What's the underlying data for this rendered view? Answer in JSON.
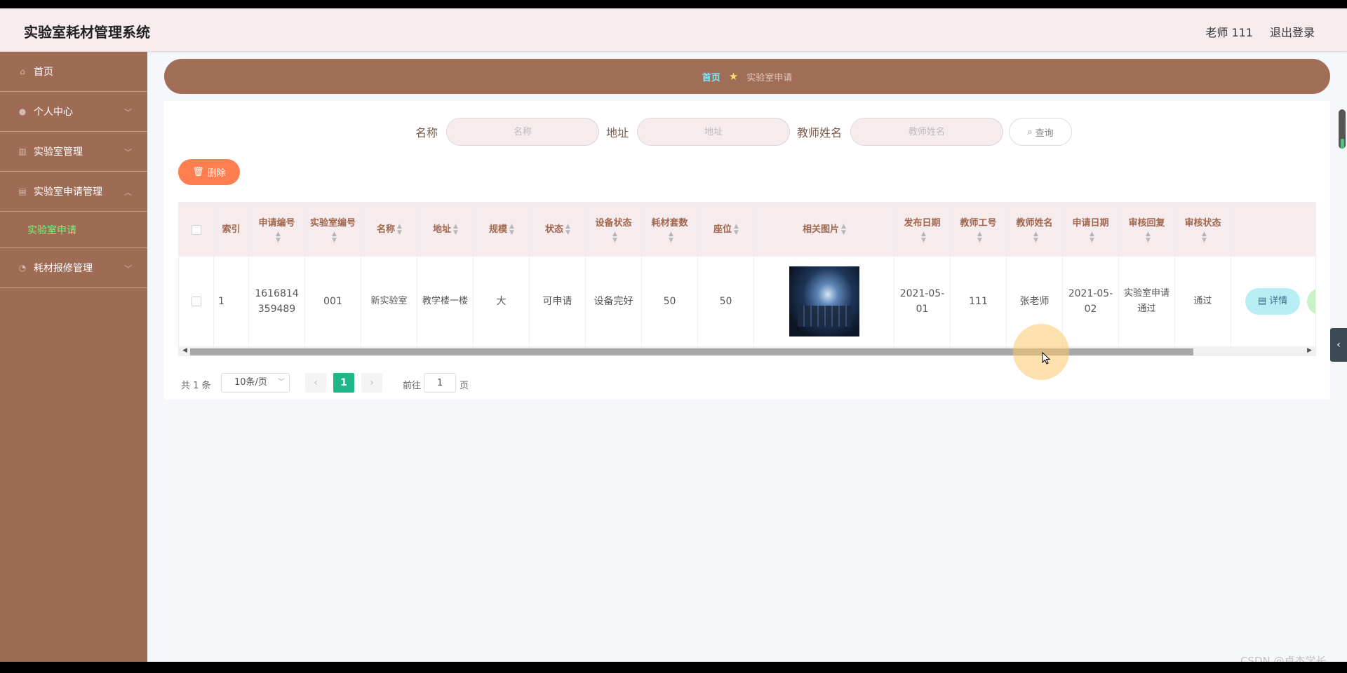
{
  "header": {
    "title": "实验室耗材管理系统",
    "user": "老师 111",
    "logout": "退出登录"
  },
  "sidebar": {
    "items": [
      {
        "label": "首页",
        "icon": "home-icon"
      },
      {
        "label": "个人中心",
        "icon": "user-icon"
      },
      {
        "label": "实验室管理",
        "icon": "chart-icon"
      },
      {
        "label": "实验室申请管理",
        "icon": "clipboard-icon",
        "sub": "实验室申请"
      },
      {
        "label": "耗材报修管理",
        "icon": "dashboard-icon"
      }
    ]
  },
  "breadcrumb": {
    "home": "首页",
    "current": "实验室申请"
  },
  "search": {
    "name_label": "名称",
    "name_placeholder": "名称",
    "address_label": "地址",
    "address_placeholder": "地址",
    "teacher_label": "教师姓名",
    "teacher_placeholder": "教师姓名",
    "query_button": "查询"
  },
  "toolbar": {
    "delete_button": "删除"
  },
  "table": {
    "headers": {
      "index": "索引",
      "app_no": "申请编号",
      "lab_no": "实验室编号",
      "name": "名称",
      "address": "地址",
      "scale": "规模",
      "status": "状态",
      "device_status": "设备状态",
      "material_sets": "耗材套数",
      "seats": "座位",
      "image": "相关图片",
      "publish_date": "发布日期",
      "teacher_id": "教师工号",
      "teacher_name": "教师姓名",
      "apply_date": "申请日期",
      "review_reply": "审核回复",
      "review_status": "审核状态"
    },
    "row": {
      "index": "1",
      "app_no": "1616814359489",
      "lab_no": "001",
      "name": "新实验室",
      "address": "教学楼一楼",
      "scale": "大",
      "status": "可申请",
      "device_status": "设备完好",
      "material_sets": "50",
      "seats": "50",
      "publish_date": "2021-05-01",
      "teacher_id": "111",
      "teacher_name": "张老师",
      "apply_date": "2021-05-02",
      "review_reply": "实验室申请通过",
      "review_status": "通过",
      "detail_button": "详情"
    }
  },
  "pagination": {
    "total": "共 1 条",
    "page_size": "10条/页",
    "current": "1",
    "goto_label": "前往",
    "goto_value": "1",
    "page_suffix": "页"
  },
  "watermark": "CSDN @卓杰学长",
  "colors": {
    "sidebar": "#9e6b55",
    "accent_orange": "#fe7e4f",
    "accent_green": "#1fb78a",
    "breadcrumb_bar": "#a06e57"
  }
}
